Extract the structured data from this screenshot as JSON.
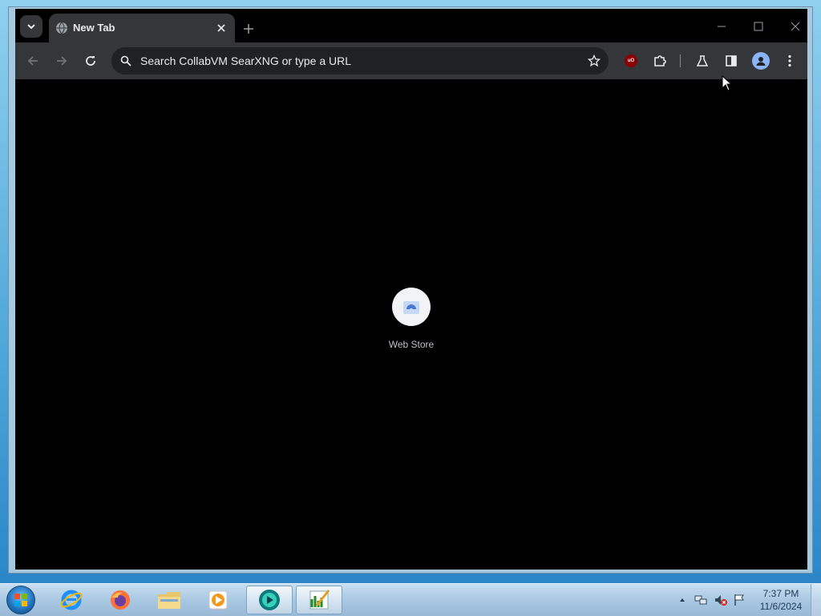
{
  "browser": {
    "tab": {
      "title": "New Tab"
    },
    "omnibox": {
      "placeholder": "Search CollabVM SearXNG or type a URL"
    },
    "extensions": {
      "ublock_badge": "uO"
    },
    "shortcuts": [
      {
        "label": "Web Store",
        "icon": "web-store-icon"
      }
    ]
  },
  "taskbar": {
    "pinned": [
      {
        "name": "internet-explorer",
        "icon": "ie-icon"
      },
      {
        "name": "firefox",
        "icon": "firefox-icon"
      },
      {
        "name": "file-explorer",
        "icon": "folder-icon"
      },
      {
        "name": "media-player",
        "icon": "media-player-icon"
      },
      {
        "name": "chrome-like-browser",
        "icon": "browser-icon"
      },
      {
        "name": "task-manager",
        "icon": "chart-icon"
      }
    ],
    "clock": {
      "time": "7:37 PM",
      "date": "11/6/2024"
    }
  },
  "colors": {
    "toolbar": "#35363a",
    "omnibox": "#202124",
    "content": "#000000",
    "text": "#e8eaed"
  }
}
